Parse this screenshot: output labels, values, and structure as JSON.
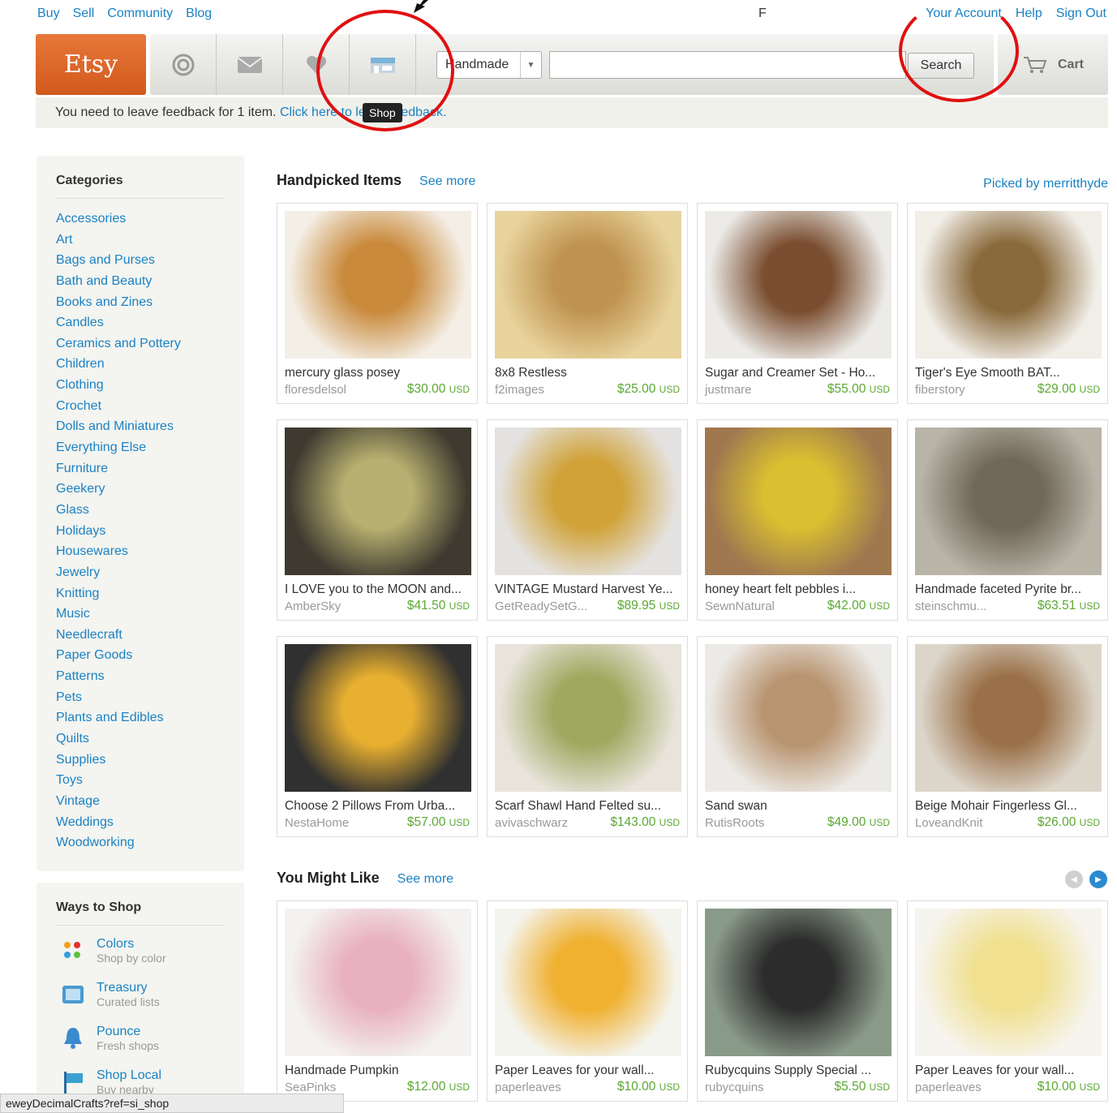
{
  "top_nav": {
    "left": [
      "Buy",
      "Sell",
      "Community",
      "Blog"
    ],
    "stray": "F",
    "right": [
      "Your Account",
      "Help",
      "Sign Out"
    ]
  },
  "header": {
    "logo": "Etsy",
    "category_select": "Handmade",
    "search_button": "Search",
    "cart_label": "Cart",
    "nav_icons": [
      "circle-icon",
      "mail-icon",
      "heart-icon",
      "shop-icon"
    ]
  },
  "tooltip": "Shop",
  "feedback": {
    "text": "You need to leave feedback for 1 item.",
    "link": "Click here to leave feedback."
  },
  "sidebar": {
    "categories_title": "Categories",
    "categories": [
      "Accessories",
      "Art",
      "Bags and Purses",
      "Bath and Beauty",
      "Books and Zines",
      "Candles",
      "Ceramics and Pottery",
      "Children",
      "Clothing",
      "Crochet",
      "Dolls and Miniatures",
      "Everything Else",
      "Furniture",
      "Geekery",
      "Glass",
      "Holidays",
      "Housewares",
      "Jewelry",
      "Knitting",
      "Music",
      "Needlecraft",
      "Paper Goods",
      "Patterns",
      "Pets",
      "Plants and Edibles",
      "Quilts",
      "Supplies",
      "Toys",
      "Vintage",
      "Weddings",
      "Woodworking"
    ],
    "ways_title": "Ways to Shop",
    "ways": [
      {
        "name": "Colors",
        "desc": "Shop by color"
      },
      {
        "name": "Treasury",
        "desc": "Curated lists"
      },
      {
        "name": "Pounce",
        "desc": "Fresh shops"
      },
      {
        "name": "Shop Local",
        "desc": "Buy nearby"
      }
    ]
  },
  "handpicked": {
    "title": "Handpicked Items",
    "see_more": "See more",
    "picked_by": "Picked by merritthyde",
    "items": [
      {
        "title": "mercury glass posey",
        "seller": "floresdelsol",
        "price": "$30.00",
        "currency": "USD",
        "colors": [
          "#c98a3c",
          "#f4efe6"
        ]
      },
      {
        "title": "8x8 Restless",
        "seller": "f2images",
        "price": "$25.00",
        "currency": "USD",
        "colors": [
          "#c09450",
          "#e8d39c"
        ]
      },
      {
        "title": "Sugar and Creamer Set - Ho...",
        "seller": "justmare",
        "price": "$55.00",
        "currency": "USD",
        "colors": [
          "#7a4e30",
          "#ecebe8"
        ]
      },
      {
        "title": "Tiger's Eye Smooth BAT...",
        "seller": "fiberstory",
        "price": "$29.00",
        "currency": "USD",
        "colors": [
          "#8a6a3c",
          "#f1eee8"
        ]
      },
      {
        "title": "I LOVE you to the MOON and...",
        "seller": "AmberSky",
        "price": "$41.50",
        "currency": "USD",
        "colors": [
          "#b8b070",
          "#3e3a30"
        ]
      },
      {
        "title": "VINTAGE Mustard Harvest Ye...",
        "seller": "GetReadySetG...",
        "price": "$89.95",
        "currency": "USD",
        "colors": [
          "#d0a238",
          "#e4e2e0"
        ]
      },
      {
        "title": "honey heart felt pebbles i...",
        "seller": "SewnNatural",
        "price": "$42.00",
        "currency": "USD",
        "colors": [
          "#d8c030",
          "#a07850"
        ]
      },
      {
        "title": "Handmade faceted Pyrite br...",
        "seller": "steinschmu...",
        "price": "$63.51",
        "currency": "USD",
        "colors": [
          "#706858",
          "#b8b4a8"
        ]
      },
      {
        "title": "Choose 2 Pillows From Urba...",
        "seller": "NestaHome",
        "price": "$57.00",
        "currency": "USD",
        "colors": [
          "#e8b030",
          "#303030"
        ]
      },
      {
        "title": "Scarf Shawl Hand Felted su...",
        "seller": "avivaschwarz",
        "price": "$143.00",
        "currency": "USD",
        "colors": [
          "#a0a860",
          "#e8e4dc"
        ]
      },
      {
        "title": "Sand swan",
        "seller": "RutisRoots",
        "price": "$49.00",
        "currency": "USD",
        "colors": [
          "#b89470",
          "#eceae6"
        ]
      },
      {
        "title": "Beige Mohair Fingerless Gl...",
        "seller": "LoveandKnit",
        "price": "$26.00",
        "currency": "USD",
        "colors": [
          "#9a7048",
          "#dcd6ca"
        ]
      }
    ]
  },
  "might_like": {
    "title": "You Might Like",
    "see_more": "See more",
    "items": [
      {
        "title": "Handmade Pumpkin",
        "seller": "SeaPinks",
        "price": "$12.00",
        "currency": "USD",
        "colors": [
          "#e8b0c0",
          "#f4f2f0"
        ]
      },
      {
        "title": "Paper Leaves for your wall...",
        "seller": "paperleaves",
        "price": "$10.00",
        "currency": "USD",
        "colors": [
          "#f0b030",
          "#f4f4ee"
        ]
      },
      {
        "title": "Rubycquins Supply Special ...",
        "seller": "rubycquins",
        "price": "$5.50",
        "currency": "USD",
        "colors": [
          "#2c2c2c",
          "#8a9a88"
        ]
      },
      {
        "title": "Paper Leaves for your wall...",
        "seller": "paperleaves",
        "price": "$10.00",
        "currency": "USD",
        "colors": [
          "#f0e090",
          "#f6f4ee"
        ]
      }
    ]
  },
  "status_bar": "eweyDecimalCrafts?ref=si_shop"
}
